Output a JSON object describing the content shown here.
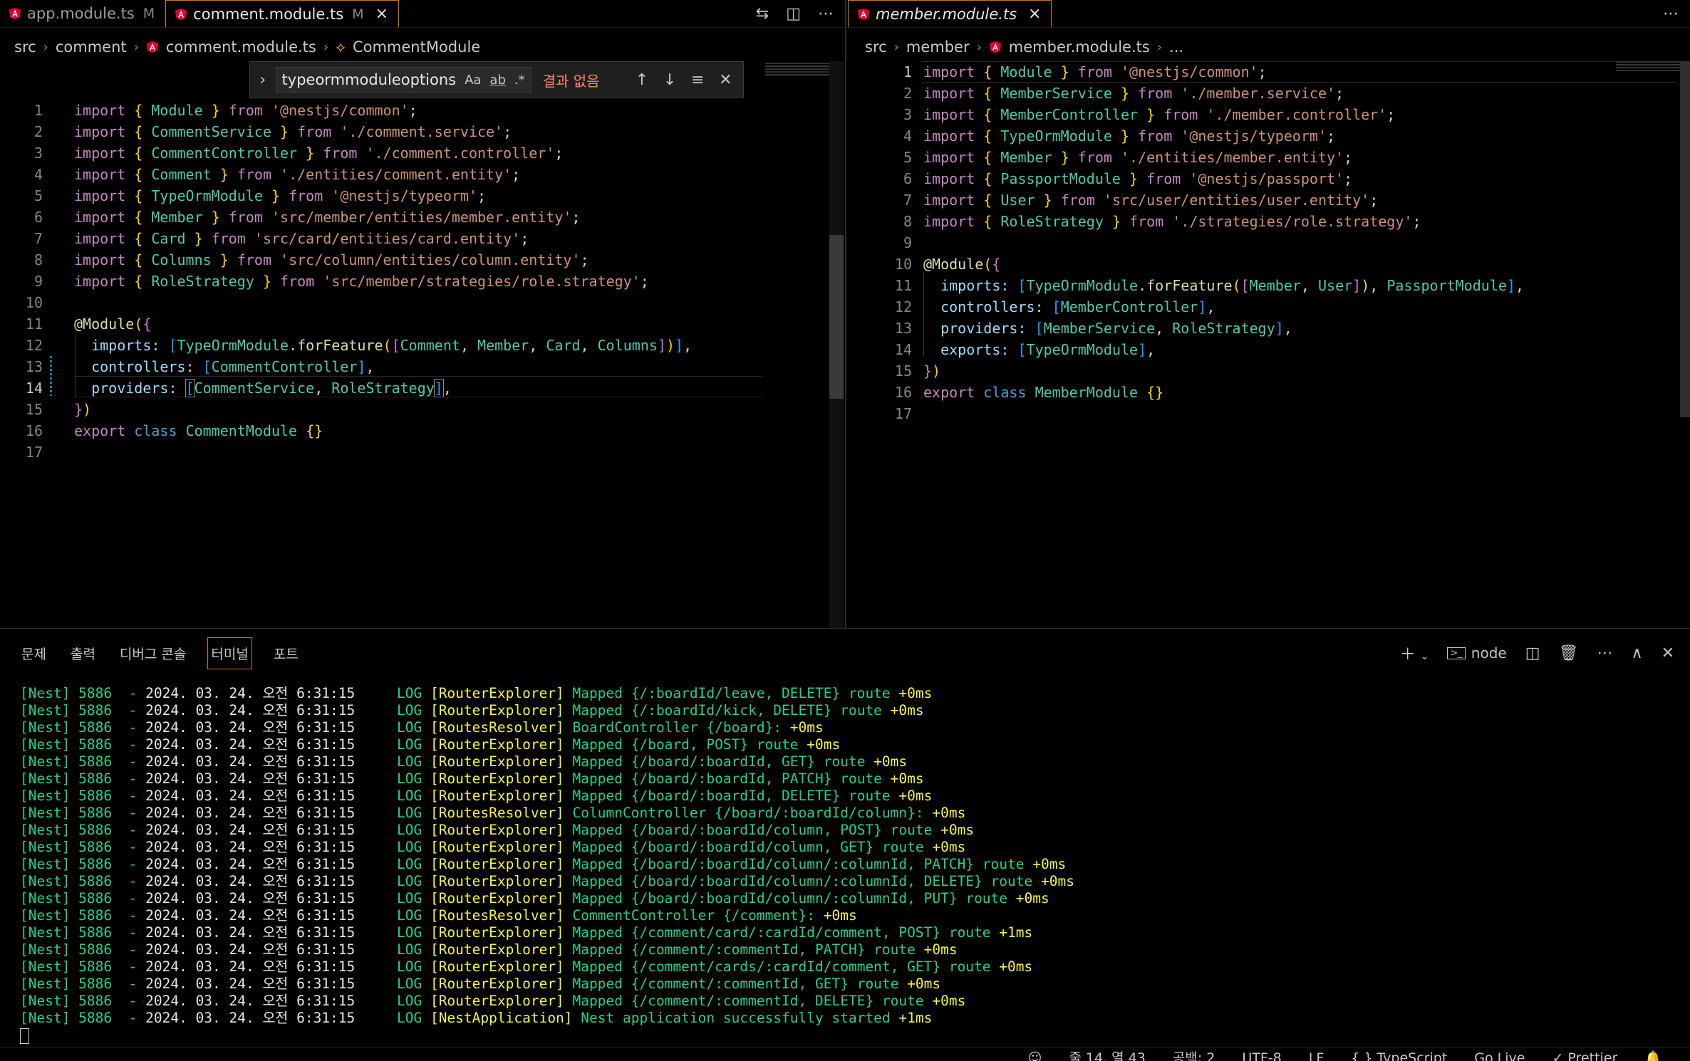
{
  "left_tabs": [
    {
      "name": "app.module.ts",
      "badge": "M"
    },
    {
      "name": "comment.module.ts",
      "badge": "M",
      "close": "×"
    }
  ],
  "right_tabs": [
    {
      "name": "member.module.ts",
      "close": "×"
    }
  ],
  "left_breadcrumb": {
    "a": "src",
    "b": "comment",
    "c": "comment.module.ts",
    "d": "CommentModule"
  },
  "right_breadcrumb": {
    "a": "src",
    "b": "member",
    "c": "member.module.ts",
    "d": "..."
  },
  "find": {
    "query": "typeormmoduleoptions",
    "opt_case": "Aa",
    "opt_word": "ab",
    "opt_regex": ".*",
    "result": "결과 없음"
  },
  "left_code": {
    "line_numbers": [
      "1",
      "2",
      "3",
      "4",
      "5",
      "6",
      "7",
      "8",
      "9",
      "10",
      "11",
      "12",
      "13",
      "14",
      "15",
      "16",
      "17"
    ],
    "current_line": "14"
  },
  "right_code": {
    "line_numbers": [
      "1",
      "2",
      "3",
      "4",
      "5",
      "6",
      "7",
      "8",
      "9",
      "10",
      "11",
      "12",
      "13",
      "14",
      "15",
      "16",
      "17"
    ],
    "current_line": "1"
  },
  "panel": {
    "tabs": [
      "문제",
      "출력",
      "디버그 콘솔",
      "터미널",
      "포트"
    ],
    "active_tab": "터미널",
    "shell": "node"
  },
  "terminal": {
    "prefix": "[Nest] 5886  - 2024. 03. 24. 오전 6:31:15     LOG ",
    "lines": [
      {
        "ctx": "[RouterExplorer]",
        "msg": "Mapped {/:boardId/leave, DELETE} route",
        "t": "+0ms"
      },
      {
        "ctx": "[RouterExplorer]",
        "msg": "Mapped {/:boardId/kick, DELETE} route",
        "t": "+0ms"
      },
      {
        "ctx": "[RoutesResolver]",
        "msg": "BoardController {/board}:",
        "t": "+0ms"
      },
      {
        "ctx": "[RouterExplorer]",
        "msg": "Mapped {/board, POST} route",
        "t": "+0ms"
      },
      {
        "ctx": "[RouterExplorer]",
        "msg": "Mapped {/board/:boardId, GET} route",
        "t": "+0ms"
      },
      {
        "ctx": "[RouterExplorer]",
        "msg": "Mapped {/board/:boardId, PATCH} route",
        "t": "+0ms"
      },
      {
        "ctx": "[RouterExplorer]",
        "msg": "Mapped {/board/:boardId, DELETE} route",
        "t": "+0ms"
      },
      {
        "ctx": "[RoutesResolver]",
        "msg": "ColumnController {/board/:boardId/column}:",
        "t": "+0ms"
      },
      {
        "ctx": "[RouterExplorer]",
        "msg": "Mapped {/board/:boardId/column, POST} route",
        "t": "+0ms"
      },
      {
        "ctx": "[RouterExplorer]",
        "msg": "Mapped {/board/:boardId/column, GET} route",
        "t": "+0ms"
      },
      {
        "ctx": "[RouterExplorer]",
        "msg": "Mapped {/board/:boardId/column/:columnId, PATCH} route",
        "t": "+0ms"
      },
      {
        "ctx": "[RouterExplorer]",
        "msg": "Mapped {/board/:boardId/column/:columnId, DELETE} route",
        "t": "+0ms"
      },
      {
        "ctx": "[RouterExplorer]",
        "msg": "Mapped {/board/:boardId/column/:columnId, PUT} route",
        "t": "+0ms"
      },
      {
        "ctx": "[RoutesResolver]",
        "msg": "CommentController {/comment}:",
        "t": "+0ms"
      },
      {
        "ctx": "[RouterExplorer]",
        "msg": "Mapped {/comment/card/:cardId/comment, POST} route",
        "t": "+1ms"
      },
      {
        "ctx": "[RouterExplorer]",
        "msg": "Mapped {/comment/:commentId, PATCH} route",
        "t": "+0ms"
      },
      {
        "ctx": "[RouterExplorer]",
        "msg": "Mapped {/comment/cards/:cardId/comment, GET} route",
        "t": "+0ms"
      },
      {
        "ctx": "[RouterExplorer]",
        "msg": "Mapped {/comment/:commentId, GET} route",
        "t": "+0ms"
      },
      {
        "ctx": "[RouterExplorer]",
        "msg": "Mapped {/comment/:commentId, DELETE} route",
        "t": "+0ms"
      },
      {
        "ctx": "[NestApplication]",
        "msg": "Nest application successfully started",
        "t": "+1ms"
      }
    ]
  },
  "status": {
    "position": "줄 14, 열 43",
    "spaces": "공백: 2",
    "encoding": "UTF-8",
    "eol": "LF",
    "language": "{ } TypeScript",
    "golive": "Go Live",
    "prettier": "✓ Prettier"
  },
  "colors": {
    "accent": "#c9771e",
    "keyword": "#c586c0",
    "string": "#ce9178",
    "class": "#4ec9b0",
    "log_green": "#23d18b",
    "log_yellow": "#f5f543"
  },
  "icons": [
    "angular-icon",
    "compare-icon",
    "split-editor-icon",
    "more-icon",
    "chevron-right-icon",
    "symbol-class-icon",
    "arrow-up-icon",
    "arrow-down-icon",
    "selection-icon",
    "close-icon",
    "plus-icon",
    "terminal-icon",
    "trash-icon",
    "maximize-icon"
  ]
}
